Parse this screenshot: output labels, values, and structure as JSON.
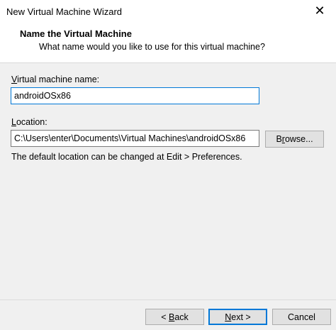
{
  "window": {
    "title": "New Virtual Machine Wizard",
    "close_glyph": "✕"
  },
  "header": {
    "title": "Name the Virtual Machine",
    "subtitle": "What name would you like to use for this virtual machine?"
  },
  "vm_name": {
    "label_mnemonic": "V",
    "label_rest": "irtual machine name:",
    "value": "androidOSx86"
  },
  "location": {
    "label_mnemonic": "L",
    "label_rest": "ocation:",
    "value": "C:\\Users\\enter\\Documents\\Virtual Machines\\androidOSx86",
    "browse_pre": "B",
    "browse_mnemonic": "r",
    "browse_post": "owse...",
    "hint": "The default location can be changed at Edit > Preferences."
  },
  "footer": {
    "back_pre": "< ",
    "back_mnemonic": "B",
    "back_post": "ack",
    "next_mnemonic": "N",
    "next_post": "ext >",
    "cancel_label": "Cancel"
  }
}
